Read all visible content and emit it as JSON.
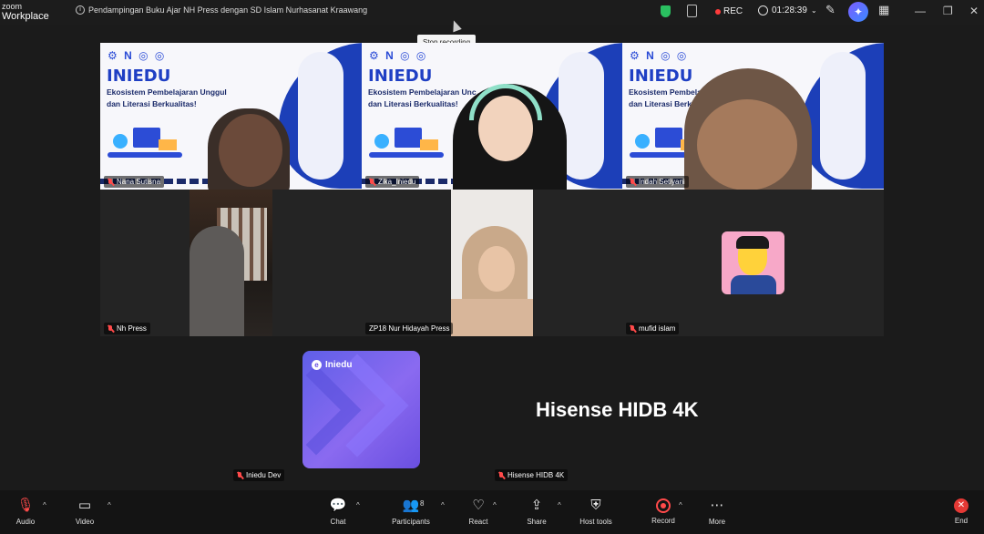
{
  "titlebar": {
    "brand_top": "zoom",
    "brand_bottom": "Workplace",
    "meeting_title": "Pendampingan Buku Ajar NH Press dengan SD Islam Nurhasanat Kraawang",
    "rec_label": "REC",
    "elapsed": "01:28:39"
  },
  "tooltip": "Stop recording",
  "slide": {
    "brand": "INIEDU",
    "tagline_line1": "Ekosistem Pembelajaran Unggul",
    "tagline_line2": "dan Literasi Berkualitas!",
    "tagline_line1_cut": "Ekosistem Pembelajaran Unc",
    "tagline_line1_cut2": "Ekosistem Pembela"
  },
  "participants": [
    {
      "name": "Nana Sutisna"
    },
    {
      "name": "Zika_Iniedu"
    },
    {
      "name": "Indah Setiyani"
    },
    {
      "name": "Nh Press"
    },
    {
      "name": "ZP18 Nur Hidayah Press"
    },
    {
      "name": "mufid islam"
    },
    {
      "name": "Iniedu Dev"
    },
    {
      "name": "Hisense HIDB 4K"
    }
  ],
  "iniedu_card_label": "Iniedu",
  "screen_share_text": "Hisense HIDB 4K",
  "toolbar": {
    "audio": "Audio",
    "video": "Video",
    "chat": "Chat",
    "participants": "Participants",
    "participant_count": "8",
    "react": "React",
    "share": "Share",
    "host_tools": "Host tools",
    "record": "Record",
    "more": "More",
    "end": "End"
  },
  "colors": {
    "active_speaker": "#2fd576",
    "brand_blue": "#1f3fc4",
    "record_red": "#ff4a4a"
  }
}
